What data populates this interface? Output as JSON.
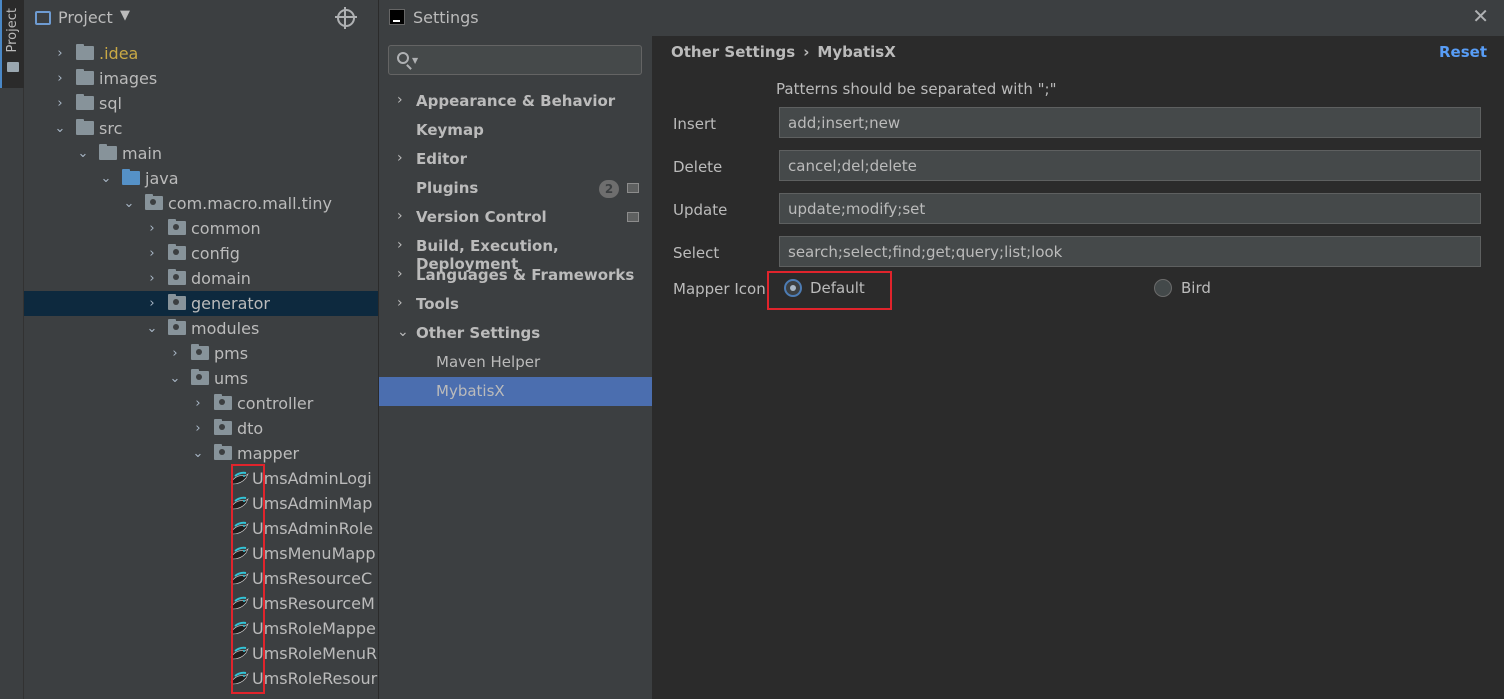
{
  "tool_strip": {
    "project_tab_label": "Project"
  },
  "project_panel": {
    "title": "Project",
    "tree": [
      {
        "label": ".idea",
        "style": "idea",
        "arrow": "›",
        "depth": 0,
        "icon": "folder-icon"
      },
      {
        "label": "images",
        "arrow": "›",
        "depth": 0,
        "icon": "folder-icon"
      },
      {
        "label": "sql",
        "arrow": "›",
        "depth": 0,
        "icon": "folder-icon"
      },
      {
        "label": "src",
        "arrow": "⌄",
        "depth": 0,
        "icon": "folder-icon"
      },
      {
        "label": "main",
        "arrow": "⌄",
        "depth": 1,
        "icon": "folder-icon"
      },
      {
        "label": "java",
        "arrow": "⌄",
        "depth": 2,
        "icon": "source-folder-icon"
      },
      {
        "label": "com.macro.mall.tiny",
        "arrow": "⌄",
        "depth": 3,
        "icon": "package-icon"
      },
      {
        "label": "common",
        "arrow": "›",
        "depth": 4,
        "icon": "package-icon"
      },
      {
        "label": "config",
        "arrow": "›",
        "depth": 4,
        "icon": "package-icon"
      },
      {
        "label": "domain",
        "arrow": "›",
        "depth": 4,
        "icon": "package-icon"
      },
      {
        "label": "generator",
        "arrow": "›",
        "depth": 4,
        "icon": "package-icon",
        "selected": true
      },
      {
        "label": "modules",
        "arrow": "⌄",
        "depth": 4,
        "icon": "package-icon"
      },
      {
        "label": "pms",
        "arrow": "›",
        "depth": 5,
        "icon": "package-icon"
      },
      {
        "label": "ums",
        "arrow": "⌄",
        "depth": 5,
        "icon": "package-icon"
      },
      {
        "label": "controller",
        "arrow": "›",
        "depth": 6,
        "icon": "package-icon"
      },
      {
        "label": "dto",
        "arrow": "›",
        "depth": 6,
        "icon": "package-icon"
      },
      {
        "label": "mapper",
        "arrow": "⌄",
        "depth": 6,
        "icon": "package-icon"
      },
      {
        "label": "UmsAdminLogi",
        "depth": 7,
        "icon": "mybatis-bird-icon"
      },
      {
        "label": "UmsAdminMap",
        "depth": 7,
        "icon": "mybatis-bird-icon"
      },
      {
        "label": "UmsAdminRole",
        "depth": 7,
        "icon": "mybatis-bird-icon"
      },
      {
        "label": "UmsMenuMapp",
        "depth": 7,
        "icon": "mybatis-bird-icon"
      },
      {
        "label": "UmsResourceC",
        "depth": 7,
        "icon": "mybatis-bird-icon"
      },
      {
        "label": "UmsResourceM",
        "depth": 7,
        "icon": "mybatis-bird-icon"
      },
      {
        "label": "UmsRoleMappe",
        "depth": 7,
        "icon": "mybatis-bird-icon"
      },
      {
        "label": "UmsRoleMenuR",
        "depth": 7,
        "icon": "mybatis-bird-icon"
      },
      {
        "label": "UmsRoleResour",
        "depth": 7,
        "icon": "mybatis-bird-icon"
      }
    ]
  },
  "settings": {
    "title": "Settings",
    "search": {
      "value": "",
      "placeholder": ""
    },
    "nav": [
      {
        "label": "Appearance & Behavior",
        "arrow": "›"
      },
      {
        "label": "Keymap"
      },
      {
        "label": "Editor",
        "arrow": "›"
      },
      {
        "label": "Plugins",
        "badge": "2",
        "project_icon": true
      },
      {
        "label": "Version Control",
        "arrow": "›",
        "project_icon": true
      },
      {
        "label": "Build, Execution, Deployment",
        "arrow": "›"
      },
      {
        "label": "Languages & Frameworks",
        "arrow": "›"
      },
      {
        "label": "Tools",
        "arrow": "›"
      },
      {
        "label": "Other Settings",
        "arrow": "⌄"
      },
      {
        "label": "Maven Helper",
        "child": true
      },
      {
        "label": "MybatisX",
        "child": true,
        "selected": true
      }
    ],
    "content": {
      "breadcrumb_parent": "Other Settings",
      "breadcrumb_sep": "›",
      "breadcrumb_current": "MybatisX",
      "reset_label": "Reset",
      "hint": "Patterns should be separated with \";\"",
      "fields": {
        "insert": {
          "label": "Insert",
          "value": "add;insert;new"
        },
        "delete": {
          "label": "Delete",
          "value": "cancel;del;delete"
        },
        "update": {
          "label": "Update",
          "value": "update;modify;set"
        },
        "select": {
          "label": "Select",
          "value": "search;select;find;get;query;list;look"
        }
      },
      "mapper_icon": {
        "label": "Mapper Icon",
        "options": [
          "Default",
          "Bird"
        ],
        "selected": "Default"
      }
    }
  },
  "colors": {
    "accent": "#4b6eaf",
    "link": "#589df6",
    "highlight_box": "#e0242c",
    "tree_selected": "#0d293e"
  }
}
